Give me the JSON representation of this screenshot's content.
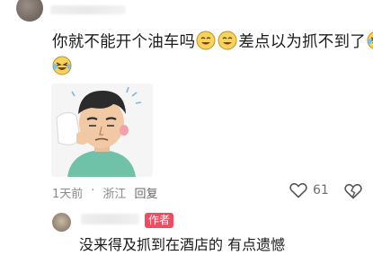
{
  "comment": {
    "text_part1": "你就不能开个油车吗",
    "text_part2": "差点以为抓不到了",
    "time": "1天前",
    "separator": "·",
    "location": "浙江",
    "reply_label": "回复",
    "like_count": "61"
  },
  "reply": {
    "author_badge": "作者",
    "text": "没来得及抓到在酒店的 有点遗憾"
  },
  "colors": {
    "badge": "#f24a5e",
    "meta": "#8a8a8a"
  }
}
